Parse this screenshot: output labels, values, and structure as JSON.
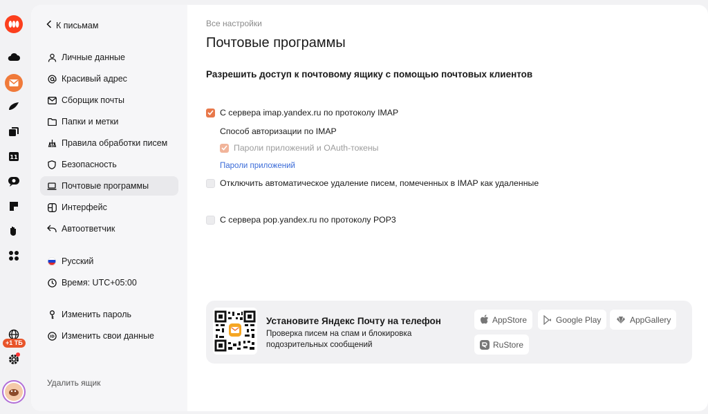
{
  "sidebar": {
    "back_label": "К письмам",
    "items": [
      {
        "label": "Личные данные",
        "icon": "person-icon"
      },
      {
        "label": "Красивый адрес",
        "icon": "at-icon"
      },
      {
        "label": "Сборщик почты",
        "icon": "envelope-icon"
      },
      {
        "label": "Папки и метки",
        "icon": "folder-icon"
      },
      {
        "label": "Правила обработки писем",
        "icon": "rules-icon"
      },
      {
        "label": "Безопасность",
        "icon": "shield-icon"
      },
      {
        "label": "Почтовые программы",
        "icon": "laptop-icon",
        "active": true
      },
      {
        "label": "Интерфейс",
        "icon": "layout-icon"
      },
      {
        "label": "Автоответчик",
        "icon": "reply-icon"
      }
    ],
    "language": "Русский",
    "timezone": "Время: UTC+05:00",
    "change_password": "Изменить пароль",
    "change_data": "Изменить свои данные",
    "delete_box": "Удалить ящик"
  },
  "rail": {
    "storage_badge": "+1 ТБ"
  },
  "main": {
    "breadcrumb": "Все настройки",
    "title": "Почтовые программы",
    "subtitle": "Разрешить доступ к почтовому ящику с помощью почтовых клиентов",
    "imap": {
      "label": "С сервера imap.yandex.ru по протоколу IMAP",
      "checked": true
    },
    "auth_title": "Способ авторизации по IMAP",
    "app_passwords_option": {
      "label": "Пароли приложений и OAuth-токены",
      "checked": true
    },
    "app_passwords_link": "Пароли приложений",
    "disable_autodelete": {
      "label": "Отключить автоматическое удаление писем, помеченных в IMAP как удаленные",
      "checked": false
    },
    "pop3": {
      "label": "С сервера pop.yandex.ru по протоколу POP3",
      "checked": false
    }
  },
  "promo": {
    "title": "Установите Яндекс Почту на телефон",
    "description": "Проверка писем на спам и блокировка подозрительных сообщений",
    "stores": [
      "AppStore",
      "Google Play",
      "AppGallery",
      "RuStore"
    ]
  },
  "colors": {
    "accent": "#e8784a",
    "link": "#3a6bd8",
    "brand": "#fc3f1d"
  }
}
